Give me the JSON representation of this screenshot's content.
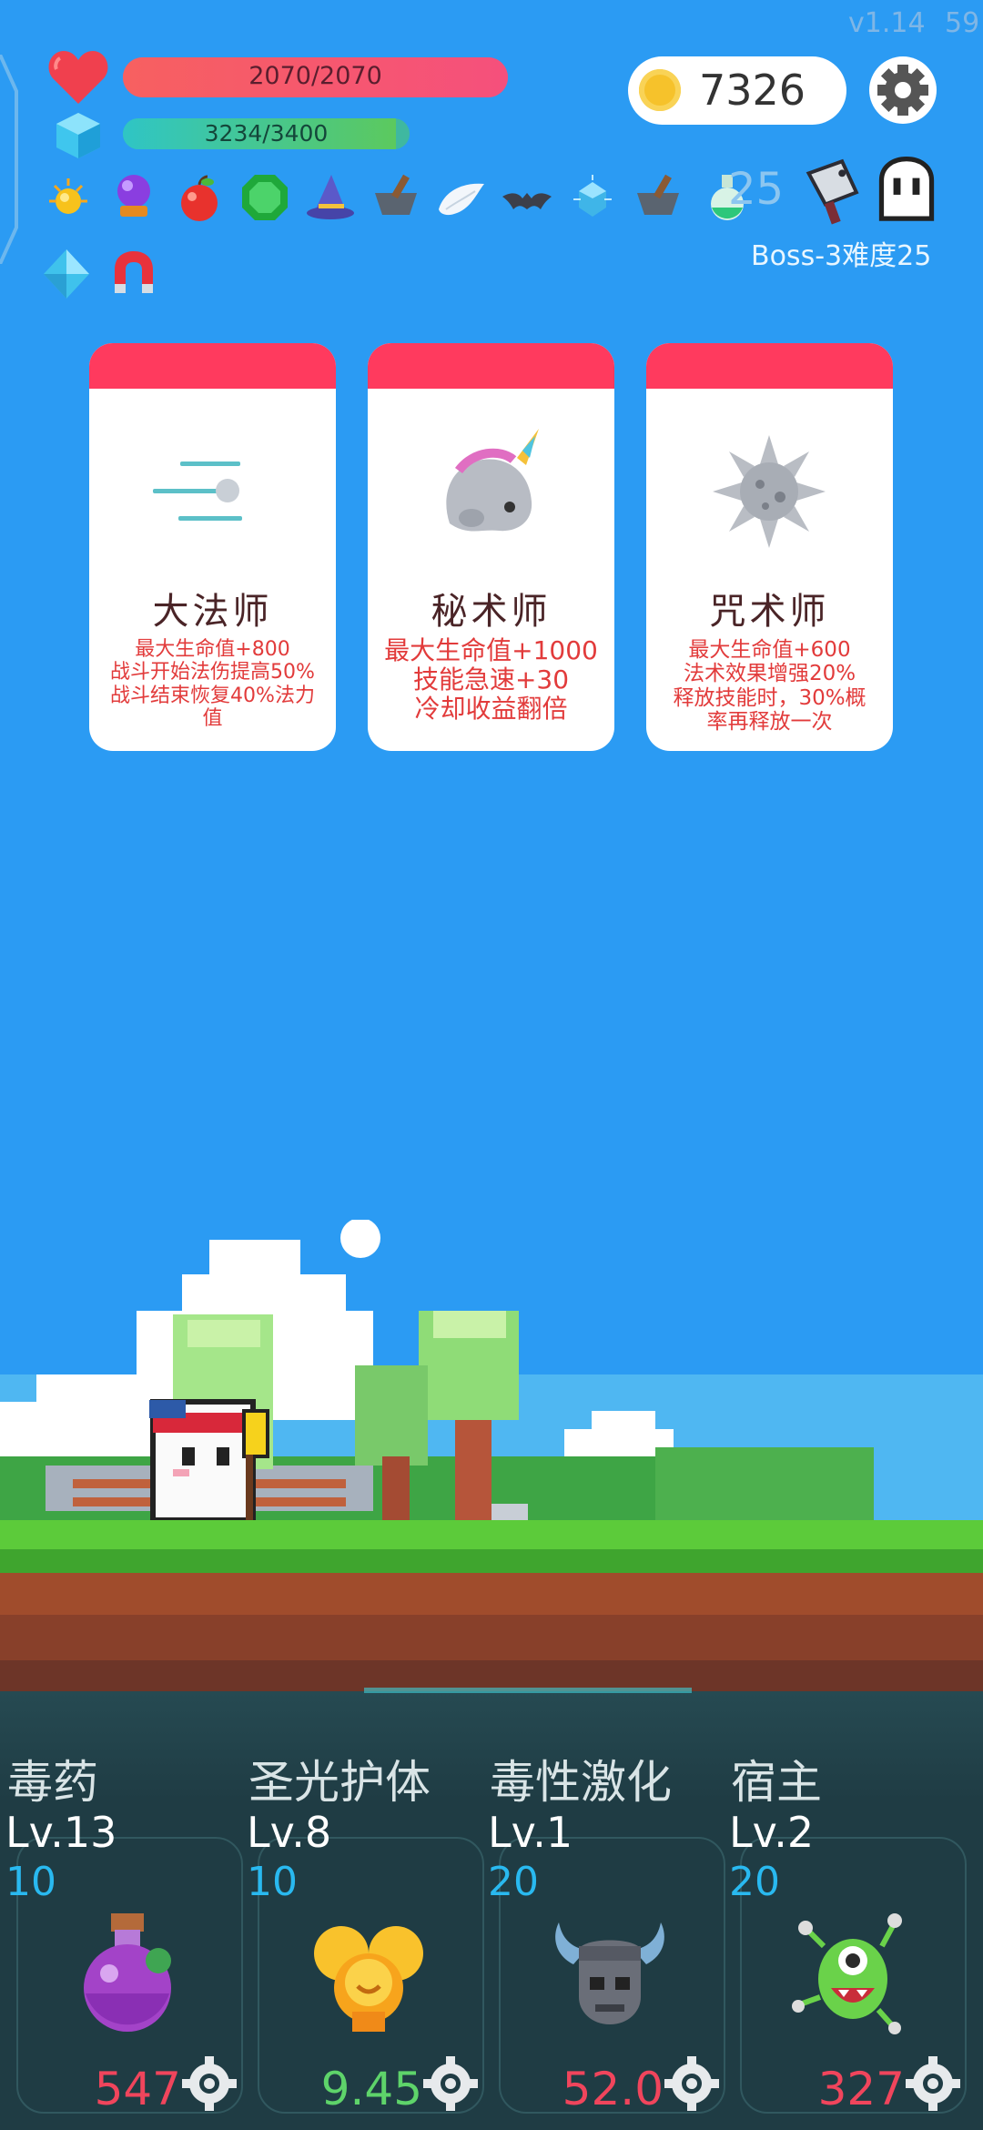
{
  "header": {
    "version": "v1.14",
    "fps": "59",
    "hp_text": "2070/2070",
    "hp_fraction": 1.0,
    "mp_text": "3234/3400",
    "mp_fraction": 0.951,
    "gold": "7326",
    "boss_text": "Boss-3难度25",
    "faded_number": "25"
  },
  "items": [
    "sun-orb-icon",
    "crystal-ball-icon",
    "apple-icon",
    "emerald-icon",
    "wizard-hat-icon",
    "mortar-icon",
    "wing-icon",
    "bat-icon",
    "ice-crystal-icon",
    "mortar-icon",
    "potion-icon",
    "cleaver-icon",
    "ghost-icon",
    "diamond-icon",
    "magnet-icon"
  ],
  "cards": [
    {
      "title": "大法师",
      "desc": [
        "最大生命值+800",
        "战斗开始法伤提高50%",
        "战斗结束恢复40%法力",
        "值"
      ],
      "icon": "speed-lines-icon"
    },
    {
      "title": "秘术师",
      "desc": [
        "最大生命值+1000",
        "技能急速+30",
        "冷却收益翻倍"
      ],
      "icon": "unicorn-icon"
    },
    {
      "title": "咒术师",
      "desc": [
        "最大生命值+600",
        "法术效果增强20%",
        "释放技能时，30%概",
        "率再释放一次"
      ],
      "icon": "spiked-ball-icon"
    }
  ],
  "skills": [
    {
      "name": "毒药",
      "level": "Lv.13",
      "cost": "10",
      "value": "547",
      "value_color": "#f0455c",
      "icon": "poison-potion-icon"
    },
    {
      "name": "圣光护体",
      "level": "Lv.8",
      "cost": "10",
      "value": "9.45",
      "value_color": "#5ed46a",
      "icon": "holy-light-icon"
    },
    {
      "name": "毒性激化",
      "level": "Lv.1",
      "cost": "20",
      "value": "52.0",
      "value_color": "#f0455c",
      "icon": "horned-skull-icon"
    },
    {
      "name": "宿主",
      "level": "Lv.2",
      "cost": "20",
      "value": "327",
      "value_color": "#f0455c",
      "icon": "green-monster-icon"
    }
  ]
}
